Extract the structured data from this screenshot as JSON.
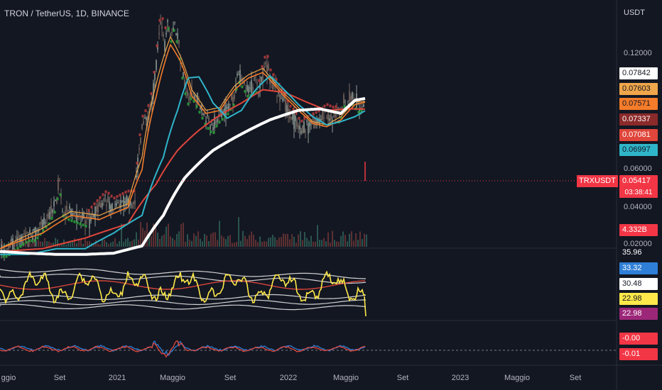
{
  "header": {
    "title": "TRON / TetherUS, 1D, BINANCE"
  },
  "axis": {
    "unit": "USDT"
  },
  "colors": {
    "bg": "#131722",
    "white_ma": "#ffffff",
    "cyan_ma": "#2fb5c9",
    "red_ma": "#e0463b",
    "orange_ma": "#f57c2a",
    "light_orange_ma": "#f0a64a",
    "candle_up": "#8d9a92",
    "candle_down": "#7a6860",
    "dots_red": "#b13a3a",
    "dots_green": "#2a9d3a",
    "rsi": "#ffe94a",
    "bands": "#e6e6e6",
    "rsi_ma": "#d8453b",
    "osc_blue": "#2f7fd8",
    "osc_red": "#e0463b"
  },
  "chart_data": {
    "type": "line",
    "title": "TRON / TetherUS, 1D, BINANCE",
    "ylabel": "USDT",
    "y_ticks": [
      "0.12000",
      "0.06000",
      "0.04000",
      "0.02000"
    ],
    "ylim": [
      0.017,
      0.19
    ],
    "x_ticks": [
      "ggio",
      "Set",
      "2021",
      "Maggio",
      "Set",
      "2022",
      "Maggio",
      "Set",
      "2023",
      "Maggio",
      "Set"
    ],
    "price_labels": [
      {
        "text": "0.07842",
        "bg": "#ffffff",
        "fg": "#131722"
      },
      {
        "text": "0.07603",
        "bg": "#f0a64a",
        "fg": "#131722"
      },
      {
        "text": "0.07571",
        "bg": "#f57c2a",
        "fg": "#131722"
      },
      {
        "text": "0.07337",
        "bg": "#8b2a2a",
        "fg": "#ffffff"
      },
      {
        "text": "0.07081",
        "bg": "#e0463b",
        "fg": "#ffffff"
      },
      {
        "text": "0.06997",
        "bg": "#2fb5c9",
        "fg": "#131722"
      }
    ],
    "symbol_tag": "TRXUSDT",
    "last_price": "0.05417",
    "countdown": "03:38:41",
    "volume_label": "4.332B",
    "rsi_labels": [
      {
        "text": "35.96",
        "bg": "#131722",
        "fg": "#ffffff"
      },
      {
        "text": "33.32",
        "bg": "#2f7fd8",
        "fg": "#ffffff"
      },
      {
        "text": "30.48",
        "bg": "#ffffff",
        "fg": "#131722"
      },
      {
        "text": "22.98",
        "bg": "#ffe94a",
        "fg": "#131722"
      },
      {
        "text": "22.98",
        "bg": "#9c2779",
        "fg": "#ffffff"
      }
    ],
    "osc_labels": [
      {
        "text": "-0.00",
        "bg": "#f23645",
        "fg": "#ffffff"
      },
      {
        "text": "-0.01",
        "bg": "#f23645",
        "fg": "#ffffff"
      }
    ],
    "series": [
      {
        "key": "price",
        "x": [
          0,
          10,
          20,
          30,
          40,
          50,
          60,
          70,
          80,
          83,
          88,
          95,
          110,
          125,
          135,
          150,
          160,
          170,
          180,
          190,
          195,
          200,
          210,
          215,
          220,
          225,
          228,
          232,
          236,
          240,
          245,
          250,
          255,
          260,
          265,
          270,
          280,
          290,
          300,
          305,
          310,
          315,
          320,
          330,
          335,
          340,
          345,
          350,
          360,
          365,
          370,
          375,
          378,
          380,
          385,
          390,
          395,
          400,
          405,
          410,
          415,
          420,
          425,
          430,
          440,
          450,
          460,
          470,
          480,
          485,
          490,
          495,
          500,
          505,
          510,
          513,
          515
        ],
        "values": [
          0.019,
          0.019,
          0.02,
          0.021,
          0.022,
          0.022,
          0.024,
          0.026,
          0.03,
          0.038,
          0.028,
          0.027,
          0.026,
          0.025,
          0.027,
          0.03,
          0.028,
          0.029,
          0.03,
          0.03,
          0.045,
          0.06,
          0.068,
          0.08,
          0.11,
          0.15,
          0.16,
          0.13,
          0.17,
          0.14,
          0.16,
          0.14,
          0.11,
          0.09,
          0.08,
          0.085,
          0.075,
          0.065,
          0.06,
          0.065,
          0.068,
          0.07,
          0.072,
          0.08,
          0.1,
          0.095,
          0.09,
          0.085,
          0.09,
          0.085,
          0.1,
          0.11,
          0.105,
          0.095,
          0.09,
          0.085,
          0.08,
          0.075,
          0.07,
          0.066,
          0.064,
          0.06,
          0.058,
          0.06,
          0.062,
          0.064,
          0.068,
          0.066,
          0.068,
          0.078,
          0.076,
          0.082,
          0.077,
          0.074,
          0.075,
          0.072,
          0.054
        ]
      },
      {
        "key": "white_ma",
        "x": [
          0,
          40,
          80,
          120,
          160,
          200,
          230,
          260,
          300,
          340,
          380,
          420,
          450,
          480,
          500,
          515
        ],
        "values": [
          0.0185,
          0.0182,
          0.018,
          0.018,
          0.0182,
          0.0195,
          0.026,
          0.037,
          0.048,
          0.056,
          0.064,
          0.07,
          0.071,
          0.068,
          0.077,
          0.0784
        ]
      },
      {
        "key": "cyan_ma",
        "x": [
          0,
          40,
          80,
          120,
          160,
          200,
          230,
          250,
          265,
          280,
          300,
          320,
          340,
          360,
          380,
          400,
          420,
          440,
          460,
          480,
          500,
          515
        ],
        "values": [
          0.018,
          0.018,
          0.019,
          0.019,
          0.022,
          0.026,
          0.045,
          0.07,
          0.095,
          0.096,
          0.075,
          0.065,
          0.07,
          0.085,
          0.097,
          0.085,
          0.074,
          0.066,
          0.061,
          0.063,
          0.066,
          0.07
        ]
      },
      {
        "key": "red_ma",
        "x": [
          0,
          60,
          120,
          180,
          220,
          250,
          280,
          310,
          340,
          370,
          400,
          430,
          460,
          490,
          515
        ],
        "values": [
          0.0185,
          0.019,
          0.021,
          0.024,
          0.035,
          0.048,
          0.058,
          0.067,
          0.075,
          0.085,
          0.083,
          0.076,
          0.07,
          0.071,
          0.0708
        ]
      },
      {
        "key": "orange_ma",
        "x": [
          0,
          60,
          100,
          140,
          180,
          200,
          220,
          240,
          255,
          270,
          290,
          310,
          330,
          350,
          370,
          385,
          400,
          420,
          440,
          460,
          480,
          500,
          515
        ],
        "values": [
          0.019,
          0.022,
          0.026,
          0.025,
          0.028,
          0.04,
          0.08,
          0.13,
          0.11,
          0.08,
          0.068,
          0.07,
          0.085,
          0.095,
          0.1,
          0.09,
          0.08,
          0.07,
          0.062,
          0.06,
          0.064,
          0.074,
          0.0757
        ]
      },
      {
        "key": "light_orange_ma",
        "x": [
          0,
          60,
          100,
          140,
          180,
          200,
          220,
          240,
          255,
          270,
          290,
          310,
          330,
          350,
          370,
          385,
          400,
          420,
          440,
          460,
          480,
          500,
          515
        ],
        "values": [
          0.019,
          0.023,
          0.027,
          0.026,
          0.029,
          0.045,
          0.09,
          0.14,
          0.115,
          0.085,
          0.07,
          0.072,
          0.088,
          0.098,
          0.104,
          0.092,
          0.082,
          0.072,
          0.063,
          0.061,
          0.066,
          0.076,
          0.076
        ]
      }
    ]
  }
}
